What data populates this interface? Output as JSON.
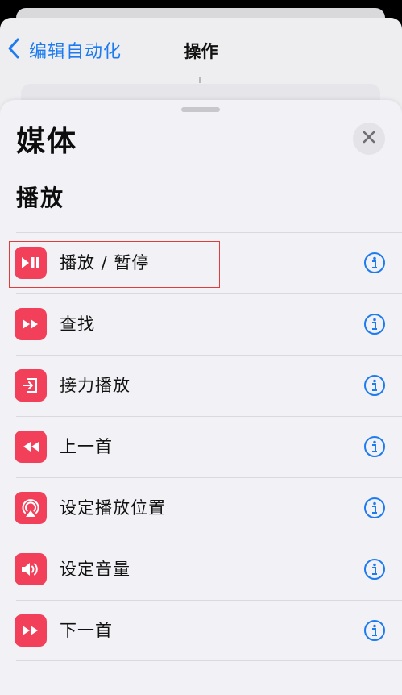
{
  "nav": {
    "back_label": "编辑自动化",
    "title": "操作"
  },
  "sheet": {
    "title": "媒体",
    "section_title": "播放"
  },
  "colors": {
    "accent": "#1d7bf0",
    "icon_bg": "#f3405a",
    "highlight": "#e23b3b"
  },
  "actions": [
    {
      "label": "播放 / 暂停",
      "icon": "play-pause-icon",
      "highlighted": true
    },
    {
      "label": "查找",
      "icon": "fast-forward-icon"
    },
    {
      "label": "接力播放",
      "icon": "handoff-icon"
    },
    {
      "label": "上一首",
      "icon": "rewind-icon"
    },
    {
      "label": "设定播放位置",
      "icon": "airplay-icon"
    },
    {
      "label": "设定音量",
      "icon": "speaker-volume-icon"
    },
    {
      "label": "下一首",
      "icon": "skip-forward-icon"
    }
  ]
}
